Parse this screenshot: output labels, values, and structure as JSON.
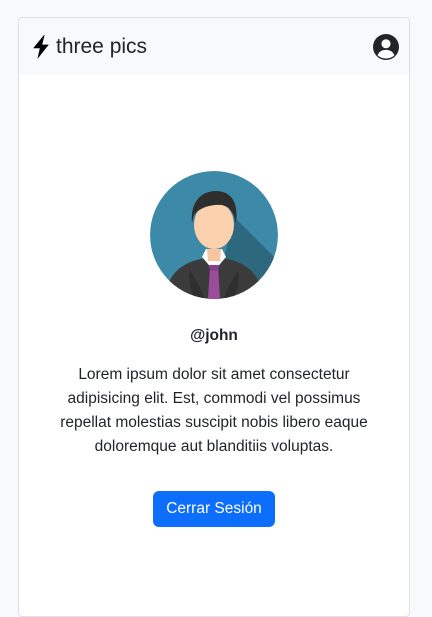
{
  "navbar": {
    "brand_icon": "lightning-bolt-icon",
    "brand_label": "three pics",
    "account_icon": "user-circle-icon"
  },
  "profile": {
    "avatar_icon": "user-avatar-icon",
    "username": "@john",
    "bio": "Lorem ipsum dolor sit amet consectetur adipisicing elit. Est, commodi vel possimus repellat molestias suscipit nobis libero eaque doloremque aut blanditiis voluptas.",
    "logout_label": "Cerrar Sesión"
  },
  "colors": {
    "primary": "#0d6efd",
    "navbar_bg": "#f8f9fa",
    "text": "#212529",
    "avatar_bg": "#3d8aa8",
    "tie": "#9b4d9b"
  }
}
